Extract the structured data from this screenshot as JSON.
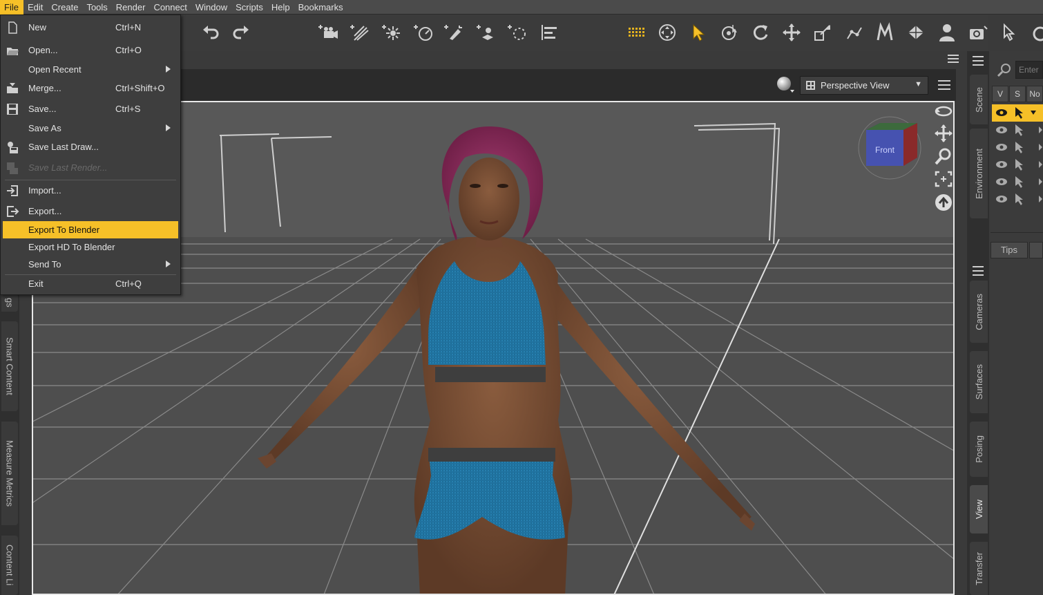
{
  "menubar": [
    "File",
    "Edit",
    "Create",
    "Tools",
    "Render",
    "Connect",
    "Window",
    "Scripts",
    "Help",
    "Bookmarks"
  ],
  "file_menu": [
    {
      "label": "New",
      "shortcut": "Ctrl+N",
      "icon": "new-document-icon"
    },
    {
      "label": "Open...",
      "shortcut": "Ctrl+O",
      "icon": "open-folder-icon"
    },
    {
      "label": "Open Recent",
      "shortcut": "",
      "submenu": true
    },
    {
      "label": "Merge...",
      "shortcut": "Ctrl+Shift+O",
      "icon": "merge-icon"
    },
    {
      "label": "Save...",
      "shortcut": "Ctrl+S",
      "icon": "save-icon"
    },
    {
      "label": "Save As",
      "shortcut": "",
      "submenu": true
    },
    {
      "label": "Save Last Draw...",
      "shortcut": "",
      "icon": "save-last-draw-icon"
    },
    {
      "label": "Save Last Render...",
      "shortcut": "",
      "icon": "save-last-render-icon",
      "disabled": true
    },
    {
      "label": "Import...",
      "shortcut": "",
      "icon": "import-icon"
    },
    {
      "label": "Export...",
      "shortcut": "",
      "icon": "export-icon"
    },
    {
      "label": "Export To Blender",
      "shortcut": "",
      "highlighted": true
    },
    {
      "label": "Export HD To Blender",
      "shortcut": ""
    },
    {
      "label": "Send To",
      "shortcut": "",
      "submenu": true
    },
    {
      "label": "Exit",
      "shortcut": "Ctrl+Q"
    }
  ],
  "viewport": {
    "camera": "Perspective View",
    "view_cube_face": "Front"
  },
  "left_tabs": [
    "gs",
    "Smart Content",
    "Measure Metrics",
    "Content Li"
  ],
  "right_tabs": [
    "Scene",
    "Environment",
    "Cameras",
    "Surfaces",
    "Posing",
    "View",
    "Transfer"
  ],
  "scene_panel": {
    "filter_placeholder": "Enter",
    "columns": [
      "V",
      "S",
      "No"
    ],
    "tips": "Tips"
  },
  "colors": {
    "accent": "#f6c028",
    "menu_bg": "#3e3e3e",
    "viewport_bg": "#555555",
    "panel_bg": "#3b3b3b"
  }
}
